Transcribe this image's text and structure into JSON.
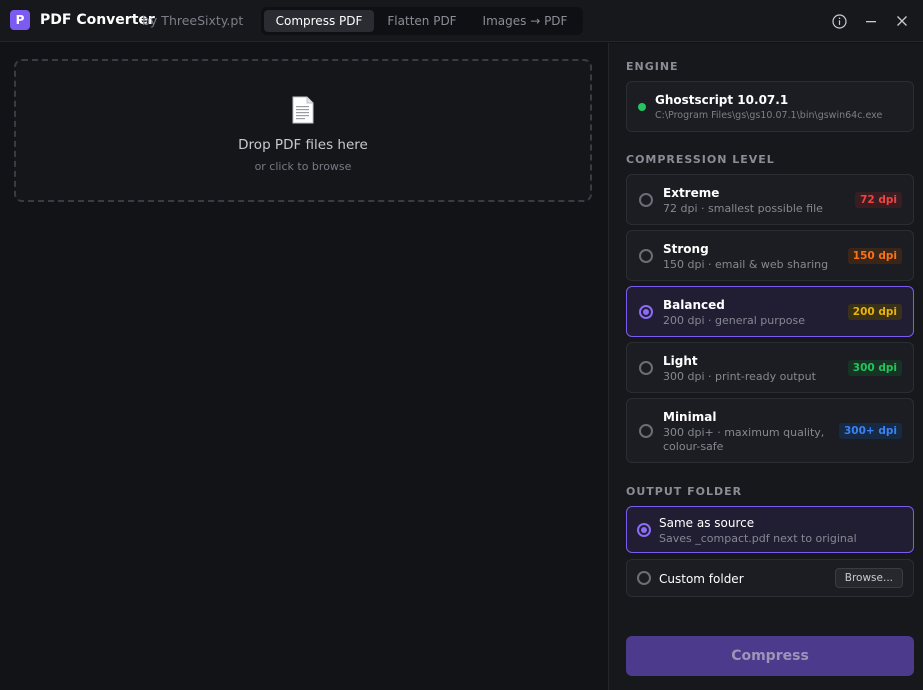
{
  "app": {
    "logo_letter": "P",
    "title": "PDF Converter",
    "subtitle": "by ThreeSixty.pt"
  },
  "tabs": [
    {
      "label": "Compress PDF",
      "active": true
    },
    {
      "label": "Flatten PDF",
      "active": false
    },
    {
      "label": "Images → PDF",
      "active": false
    }
  ],
  "window_controls": [
    "info-icon",
    "minimize-icon",
    "close-icon"
  ],
  "dropzone": {
    "icon": "document-icon",
    "title": "Drop PDF files here",
    "subtitle": "or click to browse"
  },
  "engine": {
    "section_label": "ENGINE",
    "name": "Ghostscript 10.07.1",
    "path": "C:\\Program Files\\gs\\gs10.07.1\\bin\\gswin64c.exe",
    "status_color": "#22c55e"
  },
  "compression": {
    "section_label": "COMPRESSION LEVEL",
    "selected": "Balanced",
    "levels": [
      {
        "name": "Extreme",
        "desc": "72 dpi · smallest possible file",
        "badge": "72 dpi",
        "badge_color": "#ef4444"
      },
      {
        "name": "Strong",
        "desc": "150 dpi · email & web sharing",
        "badge": "150 dpi",
        "badge_color": "#f97316"
      },
      {
        "name": "Balanced",
        "desc": "200 dpi · general purpose",
        "badge": "200 dpi",
        "badge_color": "#eab308"
      },
      {
        "name": "Light",
        "desc": "300 dpi · print-ready output",
        "badge": "300 dpi",
        "badge_color": "#22c55e"
      },
      {
        "name": "Minimal",
        "desc": "300 dpi+ · maximum quality,",
        "desc2": "colour-safe",
        "badge": "300+ dpi",
        "badge_color": "#3b82f6"
      }
    ]
  },
  "output": {
    "section_label": "OUTPUT FOLDER",
    "selected": "Same as source",
    "same_source": {
      "name": "Same as source",
      "desc": "Saves _compact.pdf next to original"
    },
    "custom": {
      "name": "Custom folder",
      "browse_label": "Browse..."
    }
  },
  "action": {
    "label": "Compress"
  },
  "colors": {
    "accent": "#7c5cf0",
    "background": "#121317",
    "panel": "#17181c"
  }
}
